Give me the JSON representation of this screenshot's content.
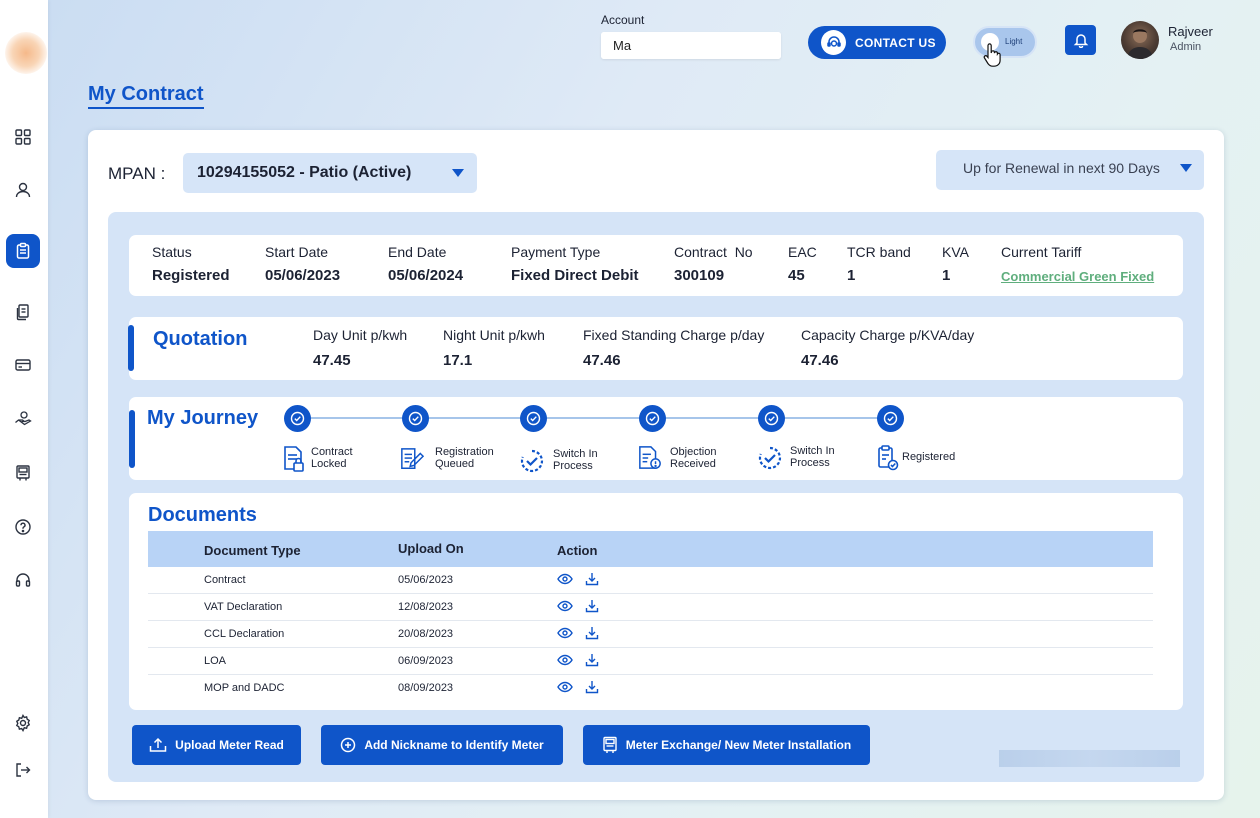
{
  "account": {
    "label": "Account",
    "value": "Ma"
  },
  "contact": {
    "label": "CONTACT US"
  },
  "theme_toggle": {
    "label": "Light"
  },
  "user": {
    "name": "Rajveer",
    "role": "Admin"
  },
  "page_title": "My Contract",
  "mpan": {
    "label": "MPAN :",
    "value": "10294155052 - Patio (Active)"
  },
  "renewal_filter": "Up for Renewal in next 90 Days",
  "contract": {
    "status_label": "Status",
    "status": "Registered",
    "start_label": "Start Date",
    "start": "05/06/2023",
    "end_label": "End Date",
    "end": "05/06/2024",
    "payment_label": "Payment Type",
    "payment": "Fixed Direct Debit",
    "contract_no_label": "Contract  No",
    "contract_no": "300109",
    "eac_label": "EAC",
    "eac": "45",
    "tcr_label": "TCR band",
    "tcr": "1",
    "kva_label": "KVA",
    "kva": "1",
    "tariff_label": "Current Tariff",
    "tariff": "Commercial Green Fixed"
  },
  "quotation": {
    "title": "Quotation",
    "day_label": "Day Unit p/kwh",
    "day": "47.45",
    "night_label": "Night Unit p/kwh",
    "night": "17.1",
    "standing_label": "Fixed Standing Charge p/day",
    "standing": "47.46",
    "capacity_label": "Capacity Charge p/KVA/day",
    "capacity": "47.46"
  },
  "journey": {
    "title": "My Journey",
    "steps": [
      {
        "line1": "Contract",
        "line2": "Locked"
      },
      {
        "line1": "Registration",
        "line2": "Queued"
      },
      {
        "line1": "Switch In",
        "line2": "Process"
      },
      {
        "line1": "Objection",
        "line2": "Received"
      },
      {
        "line1": "Switch In",
        "line2": "Process"
      },
      {
        "line1": "Registered",
        "line2": ""
      }
    ]
  },
  "documents": {
    "title": "Documents",
    "columns": [
      "Document Type",
      "Upload On",
      "Action"
    ],
    "rows": [
      {
        "type": "Contract",
        "date": "05/06/2023"
      },
      {
        "type": "VAT Declaration",
        "date": "12/08/2023"
      },
      {
        "type": "CCL Declaration",
        "date": "20/08/2023"
      },
      {
        "type": "LOA",
        "date": "06/09/2023"
      },
      {
        "type": "MOP and DADC",
        "date": "08/09/2023"
      }
    ]
  },
  "buttons": {
    "upload": "Upload Meter Read",
    "nickname": "Add Nickname to Identify Meter",
    "exchange": "Meter Exchange/ New Meter Installation"
  },
  "colors": {
    "primary": "#0f55c9",
    "panel": "#d5e4f7",
    "tariff": "#5fae7d"
  },
  "icons": {
    "sidebar": [
      "dashboard-icon",
      "user-icon",
      "contract-icon",
      "documents-icon",
      "billing-icon",
      "hand-coin-icon",
      "meter-icon",
      "help-icon",
      "headset-icon",
      "settings-icon",
      "logout-icon"
    ]
  }
}
